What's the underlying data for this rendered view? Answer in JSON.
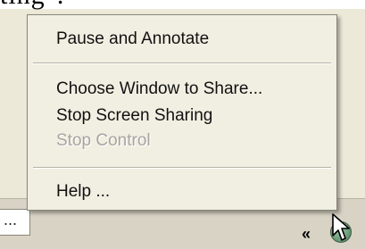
{
  "heading_fragment": "ting\".",
  "taskbar": {
    "left_button_text": "...",
    "tray_text": "«"
  },
  "menu": {
    "items": [
      {
        "label": "Pause and Annotate",
        "enabled": true
      },
      {
        "label": "Choose Window to Share...",
        "enabled": true
      },
      {
        "label": "Stop Screen Sharing",
        "enabled": true
      },
      {
        "label": "Stop Control",
        "enabled": false
      },
      {
        "label": "Help ...",
        "enabled": true
      }
    ]
  },
  "icons": {
    "tray": "screen-share-tray-icon",
    "cursor": "mouse-pointer-icon"
  }
}
